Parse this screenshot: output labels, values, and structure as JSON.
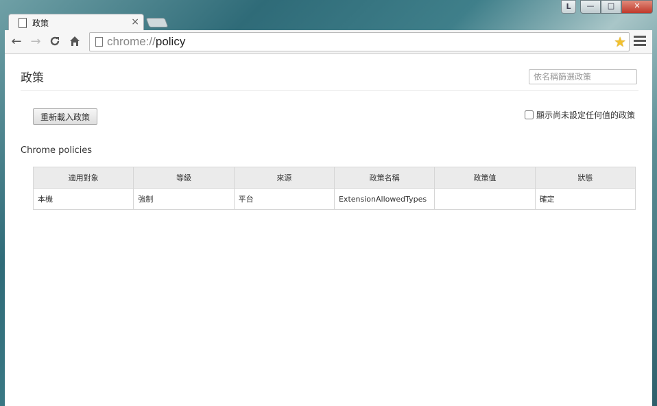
{
  "window": {
    "user_badge": "L",
    "minimize": "—",
    "maximize": "□",
    "close": "✕"
  },
  "tab": {
    "title": "政策",
    "close": "×"
  },
  "toolbar": {
    "back": "←",
    "forward": "→",
    "reload": "C",
    "home": "⌂",
    "url_scheme": "chrome://",
    "url_path": "policy",
    "star": "★"
  },
  "page": {
    "title": "政策",
    "filter_placeholder": "依名稱篩選政策",
    "reload_button": "重新載入政策",
    "show_unset_label": "顯示尚未設定任何值的政策",
    "show_unset_checked": false,
    "section_title": "Chrome policies"
  },
  "table": {
    "headers": [
      "適用對象",
      "等級",
      "來源",
      "政策名稱",
      "政策值",
      "狀態"
    ],
    "rows": [
      [
        "本機",
        "強制",
        "平台",
        "ExtensionAllowedTypes",
        "",
        "確定"
      ]
    ]
  },
  "colors": {
    "star": "#f2c12e",
    "header_bg": "#ebebeb",
    "close_button": "#c0392b"
  }
}
